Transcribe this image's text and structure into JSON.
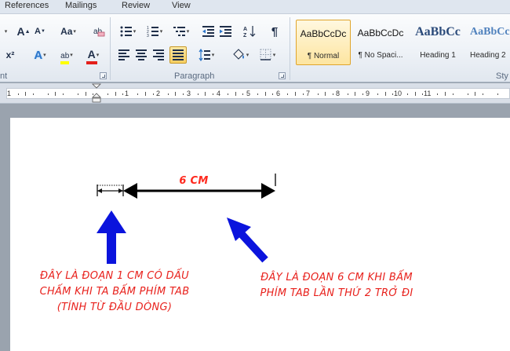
{
  "tabs": [
    "References",
    "Mailings",
    "Review",
    "View"
  ],
  "ribbon": {
    "font_group_label": "nt",
    "paragraph_group_label": "Paragraph",
    "styles_group_label": "Sty",
    "font_buttons": {
      "grow": "A",
      "shrink": "A",
      "change_case": "Aa",
      "superscript": "x²",
      "text_effects": "A",
      "highlight": "ab",
      "font_color": "A"
    },
    "pilcrow": "¶",
    "styles": [
      {
        "preview": "AaBbCcDc",
        "name": "¶ Normal",
        "selected": true
      },
      {
        "preview": "AaBbCcDc",
        "name": "¶ No Spaci...",
        "selected": false
      },
      {
        "preview": "AaBbCc",
        "name": "Heading 1",
        "selected": false
      },
      {
        "preview": "AaBbCc",
        "name": "Heading 2",
        "selected": false
      }
    ]
  },
  "ruler": {
    "numbers": [
      "1",
      "1",
      "2",
      "3",
      "4",
      "5",
      "6",
      "7",
      "8",
      "9",
      "10",
      "11"
    ]
  },
  "document": {
    "measure_label": "6 CM",
    "left_annotation": [
      "ĐÂY LÀ ĐOẠN 1 CM CÓ DẤU",
      "CHẤM KHI TA BẤM PHÍM TAB",
      "(TÍNH TỪ ĐẦU DÒNG)"
    ],
    "right_annotation": [
      "ĐÂY LÀ ĐOẠN 6 CM KHI BẤM",
      "PHÍM TAB LẦN THỨ 2 TRỞ ĐI"
    ]
  },
  "colors": {
    "annotation_red": "#e8211c",
    "arrow_blue": "#0b14dd",
    "page": "#ffffff",
    "workspace": "#9aa3ae"
  }
}
